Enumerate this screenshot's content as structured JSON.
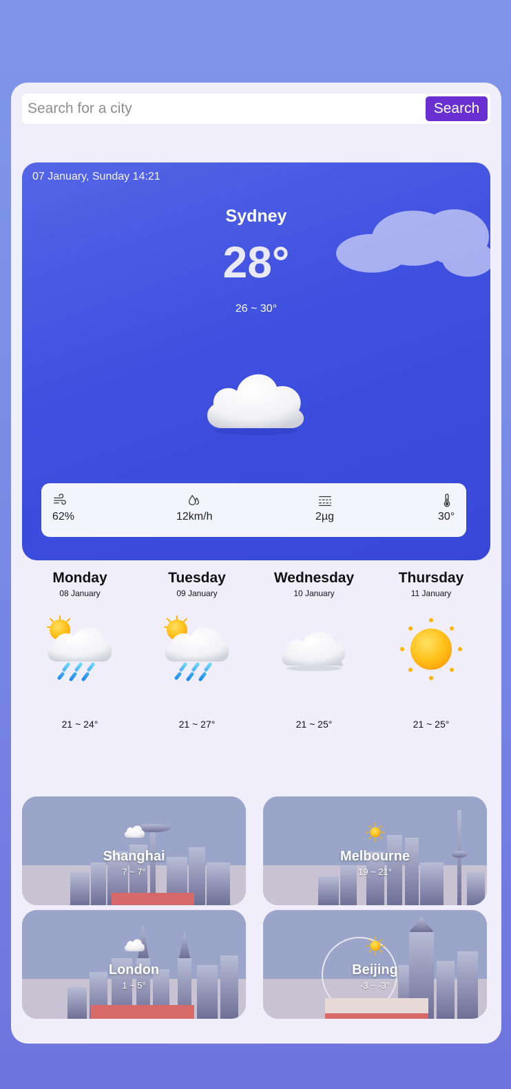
{
  "search": {
    "placeholder": "Search for a city",
    "button_label": "Search"
  },
  "current": {
    "datetime": "07 January, Sunday 14:21",
    "city": "Sydney",
    "temperature": "28°",
    "range": "26 ~ 30°",
    "condition_icon": "cloud-icon",
    "stats": {
      "humidity": {
        "icon": "wind-icon",
        "value": "62%"
      },
      "wind": {
        "icon": "droplets-icon",
        "value": "12km/h"
      },
      "pollution": {
        "icon": "haze-icon",
        "value": "2µg"
      },
      "feels_like": {
        "icon": "thermometer-icon",
        "value": "30°"
      }
    }
  },
  "forecast": [
    {
      "day": "Monday",
      "date": "08 January",
      "range": "21 ~ 24°",
      "icon": "sun-rain-icon"
    },
    {
      "day": "Tuesday",
      "date": "09 January",
      "range": "21 ~ 27°",
      "icon": "sun-rain-icon"
    },
    {
      "day": "Wednesday",
      "date": "10 January",
      "range": "21 ~ 25°",
      "icon": "cloud-icon"
    },
    {
      "day": "Thursday",
      "date": "11 January",
      "range": "21 ~ 25°",
      "icon": "sun-icon"
    }
  ],
  "cities": [
    {
      "name": "Shanghai",
      "range": "7 ~ 7°",
      "icon": "cloud-icon"
    },
    {
      "name": "Melbourne",
      "range": "19 ~ 21°",
      "icon": "sun-icon"
    },
    {
      "name": "London",
      "range": "1 ~ 5°",
      "icon": "cloud-icon"
    },
    {
      "name": "Beijing",
      "range": "-3 ~ -3°",
      "icon": "sun-icon"
    }
  ],
  "colors": {
    "accent": "#6a2fd1",
    "hero_blue": "#3f4fe0",
    "card_bg": "#f1eefb"
  }
}
